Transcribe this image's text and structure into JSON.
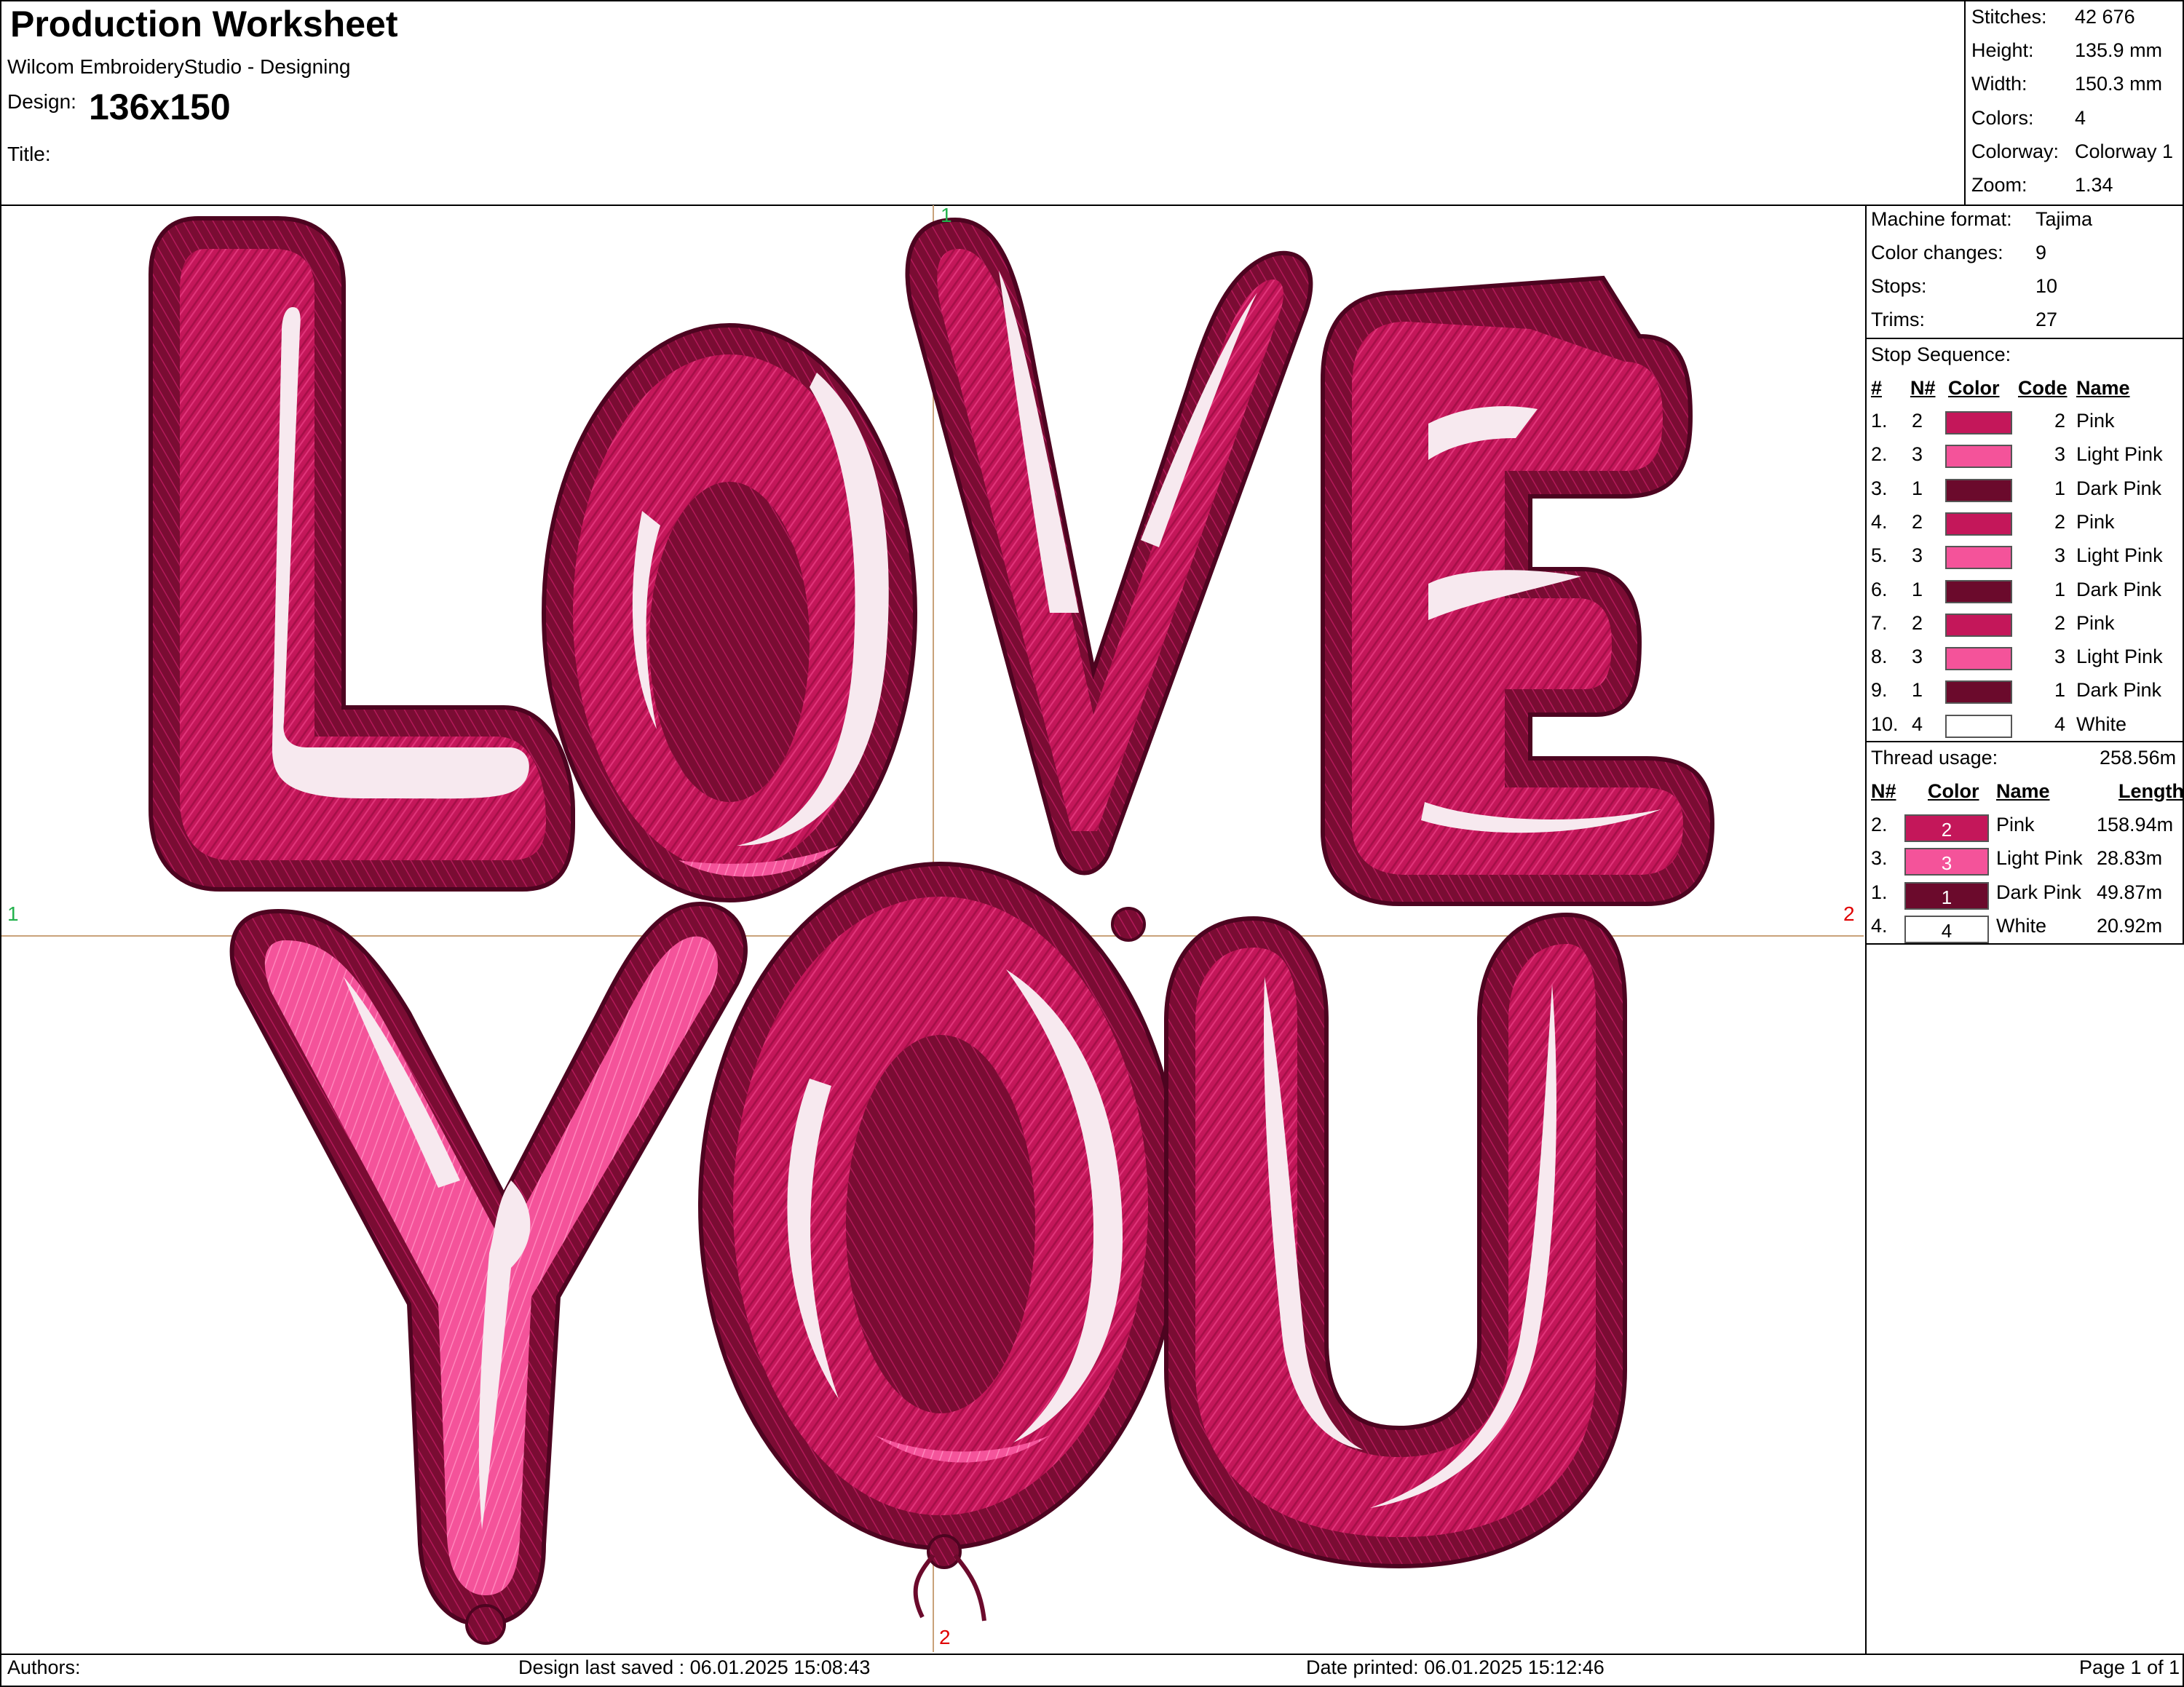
{
  "header": {
    "title": "Production Worksheet",
    "app": "Wilcom EmbroideryStudio - Designing",
    "design_label": "Design:",
    "design_value": "136x150",
    "title_label": "Title:"
  },
  "summary": [
    {
      "label": "Stitches:",
      "value": "42 676"
    },
    {
      "label": "Height:",
      "value": "135.9 mm"
    },
    {
      "label": "Width:",
      "value": "150.3 mm"
    },
    {
      "label": "Colors:",
      "value": "4"
    },
    {
      "label": "Colorway:",
      "value": "Colorway 1"
    },
    {
      "label": "Zoom:",
      "value": "1.34"
    }
  ],
  "machine": [
    {
      "label": "Machine format:",
      "value": "Tajima"
    },
    {
      "label": "Color changes:",
      "value": "9"
    },
    {
      "label": "Stops:",
      "value": "10"
    },
    {
      "label": "Trims:",
      "value": "27"
    }
  ],
  "stop_sequence": {
    "title": "Stop Sequence:",
    "headers": [
      "#",
      "N#",
      "Color",
      "Code",
      "Name"
    ],
    "rows": [
      {
        "idx": "1.",
        "n": "2",
        "color": "#c4175a",
        "code": "2",
        "name": "Pink"
      },
      {
        "idx": "2.",
        "n": "3",
        "color": "#f4539a",
        "code": "3",
        "name": "Light Pink"
      },
      {
        "idx": "3.",
        "n": "1",
        "color": "#6b0a2c",
        "code": "1",
        "name": "Dark Pink"
      },
      {
        "idx": "4.",
        "n": "2",
        "color": "#c4175a",
        "code": "2",
        "name": "Pink"
      },
      {
        "idx": "5.",
        "n": "3",
        "color": "#f4539a",
        "code": "3",
        "name": "Light Pink"
      },
      {
        "idx": "6.",
        "n": "1",
        "color": "#6b0a2c",
        "code": "1",
        "name": "Dark Pink"
      },
      {
        "idx": "7.",
        "n": "2",
        "color": "#c4175a",
        "code": "2",
        "name": "Pink"
      },
      {
        "idx": "8.",
        "n": "3",
        "color": "#f4539a",
        "code": "3",
        "name": "Light Pink"
      },
      {
        "idx": "9.",
        "n": "1",
        "color": "#6b0a2c",
        "code": "1",
        "name": "Dark Pink"
      },
      {
        "idx": "10.",
        "n": "4",
        "color": "#ffffff",
        "code": "4",
        "name": "White"
      }
    ]
  },
  "thread_usage": {
    "title": "Thread usage:",
    "total": "258.56m",
    "headers": [
      "N#",
      "Color",
      "Name",
      "Length"
    ],
    "rows": [
      {
        "idx": "2.",
        "color": "#c4175a",
        "code": "2",
        "name": "Pink",
        "length": "158.94m"
      },
      {
        "idx": "3.",
        "color": "#f4539a",
        "code": "3",
        "name": "Light Pink",
        "length": "28.83m"
      },
      {
        "idx": "1.",
        "color": "#6b0a2c",
        "code": "1",
        "name": "Dark Pink",
        "length": "49.87m"
      },
      {
        "idx": "4.",
        "color": "#ffffff",
        "code": "4",
        "name": "White",
        "length": "20.92m"
      }
    ]
  },
  "markers": {
    "top": "1",
    "left": "1",
    "right": "2",
    "bottom": "2"
  },
  "artwork": {
    "text_line1": "LOVE",
    "text_line2": "YOU"
  },
  "footer": {
    "authors": "Authors:",
    "saved": "Design last saved : 06.01.2025 15:08:43",
    "printed": "Date printed: 06.01.2025 15:12:46",
    "page": "Page 1 of 1"
  }
}
